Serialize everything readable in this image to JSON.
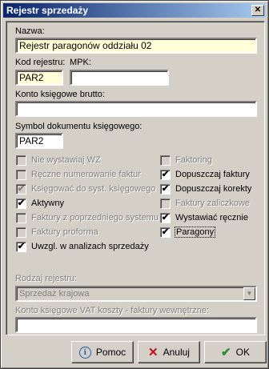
{
  "window": {
    "title": "Rejestr sprzedaży",
    "close_glyph": "✕"
  },
  "nazwa": {
    "label": "Nazwa:",
    "value": "Rejestr paragonów oddziału 02"
  },
  "kod": {
    "label": "Kod rejestru:",
    "value": "PAR2"
  },
  "mpk": {
    "label": "MPK:",
    "value": ""
  },
  "konto_brutto": {
    "label": "Konto księgowe brutto:",
    "value": ""
  },
  "symbol": {
    "label": "Symbol dokumentu księgowego:",
    "value": "PAR2"
  },
  "checks_left": [
    {
      "label": "Nie wystawiaj WZ",
      "checked": false,
      "enabled": false
    },
    {
      "label": "Ręczne numerowanie faktur",
      "checked": false,
      "enabled": false
    },
    {
      "label": "Księgować do syst. księgowego",
      "checked": true,
      "enabled": false
    },
    {
      "label": "Aktywny",
      "checked": true,
      "enabled": true
    },
    {
      "label": "Faktury z poprzedniego systemu",
      "checked": false,
      "enabled": false
    },
    {
      "label": "Faktury proforma",
      "checked": false,
      "enabled": false
    },
    {
      "label": "Uwzgl. w analizach sprzedaży",
      "checked": true,
      "enabled": true
    }
  ],
  "checks_right": [
    {
      "label": "Faktoring",
      "checked": false,
      "enabled": false
    },
    {
      "label": "Dopuszczaj faktury",
      "checked": true,
      "enabled": true
    },
    {
      "label": "Dopuszczaj korekty",
      "checked": true,
      "enabled": true
    },
    {
      "label": "Faktury zaliczkowe",
      "checked": false,
      "enabled": false
    },
    {
      "label": "Wystawiać ręcznie",
      "checked": true,
      "enabled": true
    },
    {
      "label": "Paragony",
      "checked": true,
      "enabled": true
    }
  ],
  "check_mark": "✔",
  "rodzaj": {
    "label": "Rodzaj rejestru:",
    "value": "Sprzedaż krajowa",
    "arrow": "▼"
  },
  "konto_vat": {
    "label": "Konto księgowe VAT koszty - faktury wewnętrzne:",
    "value": ""
  },
  "buttons": {
    "help": {
      "label": "Pomoc",
      "icon": "i"
    },
    "cancel": {
      "label": "Anuluj",
      "icon": "✕"
    },
    "ok": {
      "label": "OK",
      "icon": "✔"
    }
  }
}
